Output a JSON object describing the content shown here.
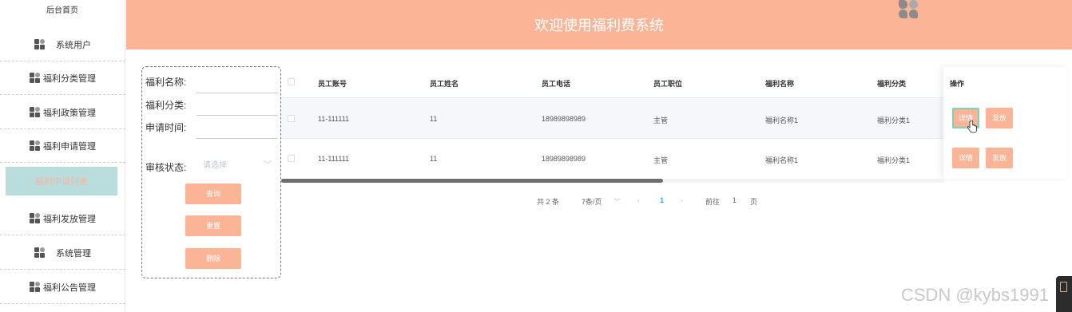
{
  "sidebar": {
    "home": "后台首页",
    "items": [
      {
        "label": "系统用户"
      },
      {
        "label": "福利分类管理"
      },
      {
        "label": "福利政策管理"
      },
      {
        "label": "福利申请管理"
      },
      {
        "label": "福利申请列表"
      },
      {
        "label": "福利发放管理"
      },
      {
        "label": "系统管理"
      },
      {
        "label": "福利公告管理"
      }
    ]
  },
  "header": {
    "title": "欢迎使用福利费系统"
  },
  "search": {
    "name_label": "福利名称:",
    "category_label": "福利分类:",
    "time_label": "申请时间:",
    "status_label": "审核状态:",
    "status_placeholder": "请选择",
    "query_button": "查询",
    "reset_button": "重置",
    "delete_button": "删除"
  },
  "table": {
    "headers": [
      "员工账号",
      "员工姓名",
      "员工电话",
      "员工职位",
      "福利名称",
      "福利分类",
      "操作"
    ],
    "rows": [
      {
        "account": "11-111111",
        "name": "11",
        "phone": "18989898989",
        "position": "主管",
        "welfare_name": "福利名称1",
        "welfare_category": "福利分类1"
      },
      {
        "account": "11-111111",
        "name": "11",
        "phone": "18989898989",
        "position": "主管",
        "welfare_name": "福利名称1",
        "welfare_category": "福利分类1"
      }
    ],
    "detail_button": "详情",
    "issue_button": "发放"
  },
  "pagination": {
    "total": "共 2 条",
    "page_size": "7条/页",
    "current": "1",
    "goto_label": "前往",
    "goto_value": "1",
    "page_unit": "页"
  },
  "watermark": "CSDN @kybs1991",
  "colors": {
    "accent": "#fbb596",
    "active_bg": "#b9dcdc"
  }
}
